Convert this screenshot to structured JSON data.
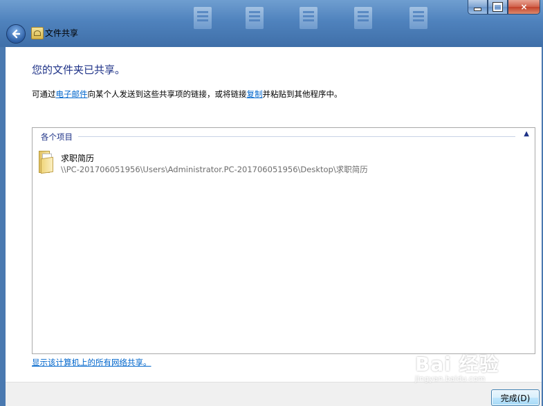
{
  "window": {
    "title": "文件共享",
    "buttons": {
      "minimize": "minimize-icon",
      "maximize": "maximize-icon",
      "close": "×"
    }
  },
  "main": {
    "heading": "您的文件夹已共享。",
    "description": {
      "part1": "可通过",
      "email_link": "电子邮件",
      "part2": "向某个人发送到这些共享项的链接，或将链接",
      "copy_link": "复制",
      "part3": "并粘贴到其他程序中。"
    },
    "items_group": {
      "header": "各个项目",
      "collapse_glyph": "▲",
      "items": [
        {
          "name": "求职简历",
          "path": "\\\\PC-201706051956\\Users\\Administrator.PC-201706051956\\Desktop\\求职简历",
          "icon": "folder-icon"
        }
      ]
    },
    "show_all_link": "显示该计算机上的所有网络共享。"
  },
  "footer": {
    "finish_button": "完成(D)"
  },
  "watermark": {
    "main": "Bai 经验",
    "sub": "jingyan.baidu.com"
  },
  "colors": {
    "heading": "#1e3287",
    "link": "#0066cc",
    "frame": "#4f82bd"
  }
}
